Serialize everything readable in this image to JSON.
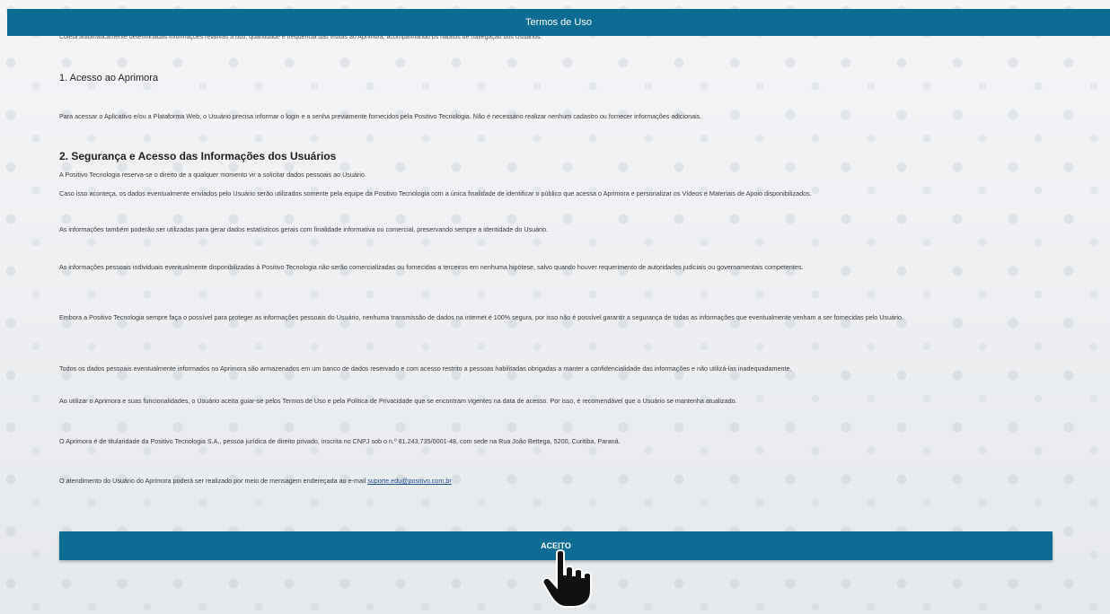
{
  "header": {
    "title": "Termos de Uso"
  },
  "intro_cut": "Coleta automaticamente determinadas informações relativas à uso, quantidade e frequência das visitas ao Aprimora, acompanhando os hábitos de navegação dos Usuários.",
  "section1": {
    "title": "1. Acesso ao Aprimora",
    "body": "Para acessar o Aplicativo e/ou a Plataforma Web, o Usuário precisa informar o login e a senha previamente fornecidos pela Positivo Tecnologia. Não é necessário realizar nenhum cadastro ou fornecer informações adicionais."
  },
  "section2": {
    "title": "2. Segurança e Acesso das Informações dos Usuários",
    "p1": "A Positivo Tecnologia reserva-se o direito de a qualquer momento vir a solicitar dados pessoais ao Usuário.",
    "p2": "Caso isso aconteça, os dados eventualmente enviados pelo Usuário serão utilizados somente pela equipe da Positivo Tecnologia com a única finalidade de identificar o público que acessa o Aprimora e personalizar os Vídeos e Materiais de Apoio disponibilizados.",
    "p3": "As informações também poderão ser utilizadas para gerar dados estatísticos gerais com finalidade informativa ou comercial, preservando sempre a identidade do Usuário.",
    "p4": "As informações pessoais individuais eventualmente disponibilizadas à Positivo Tecnologia não serão comercializadas ou fornecidas a terceiros em nenhuma hipótese, salvo quando houver requerimento de autoridades judiciais ou governamentais competentes.",
    "p5": "Embora a Positivo Tecnologia sempre faça o possível para proteger as informações pessoais do Usuário, nenhuma transmissão de dados na internet é 100% segura, por isso não é possível garantir a segurança de todas as informações que eventualmente venham a ser fornecidas pelo Usuário.",
    "p6": "Todos os dados pessoais eventualmente informados no Aprimora são armazenados em um banco de dados reservado e com acesso restrito a pessoas habilitadas obrigadas a manter a confidencialidade das informações e não utilizá-las inadequadamente.",
    "p7": "Ao utilizar o Aprimora e suas funcionalidades, o Usuário aceita guiar-se pelos Termos de Uso e pela Política de Privacidade que se encontram vigentes na data de acesso. Por isso, é recomendável que o Usuário se mantenha atualizado.",
    "p8": "O Aprimora é de titularidade da Positivo Tecnologia S.A., pessoa jurídica de direito privado, inscrita no CNPJ sob o n.º 81.243.735/0001-48, com sede na Rua João Bettega, 5200, Curitiba, Paraná.",
    "p9_prefix": "O atendimento do Usuário do Aprimora poderá ser realizado por meio de mensagem endereçada ao e-mail ",
    "p9_email": "suporte.edu@positivo.com.br"
  },
  "accept_button": {
    "label": "ACEITO"
  },
  "colors": {
    "accent": "#0c6c94",
    "background": "#eef0f2"
  },
  "cursor_icon": "hand-pointer-icon"
}
